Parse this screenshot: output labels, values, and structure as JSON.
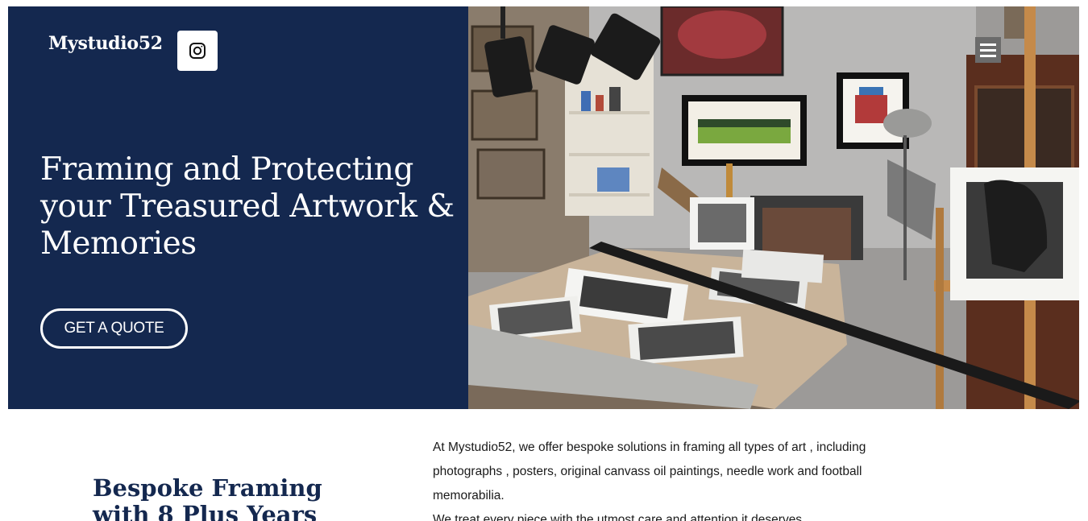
{
  "header": {
    "brand": "Mystudio52",
    "instagram_icon": "instagram-icon",
    "menu_icon": "hamburger-menu-icon"
  },
  "hero": {
    "headline": "Framing and Protecting your Treasured Artwork & Memories",
    "cta_label": "GET A QUOTE",
    "background_color": "#14284f",
    "photo": "framing studio workshop with easels, mat boards and black-and-white portrait prints"
  },
  "about": {
    "heading": "Bespoke Framing with 8 Plus Years",
    "paragraph1": "At Mystudio52, we offer bespoke solutions in framing all types of art , including photographs , posters, original canvass oil paintings, needle work and football memorabilia.",
    "paragraph2": "We treat every piece with the utmost care and attention it deserves."
  }
}
